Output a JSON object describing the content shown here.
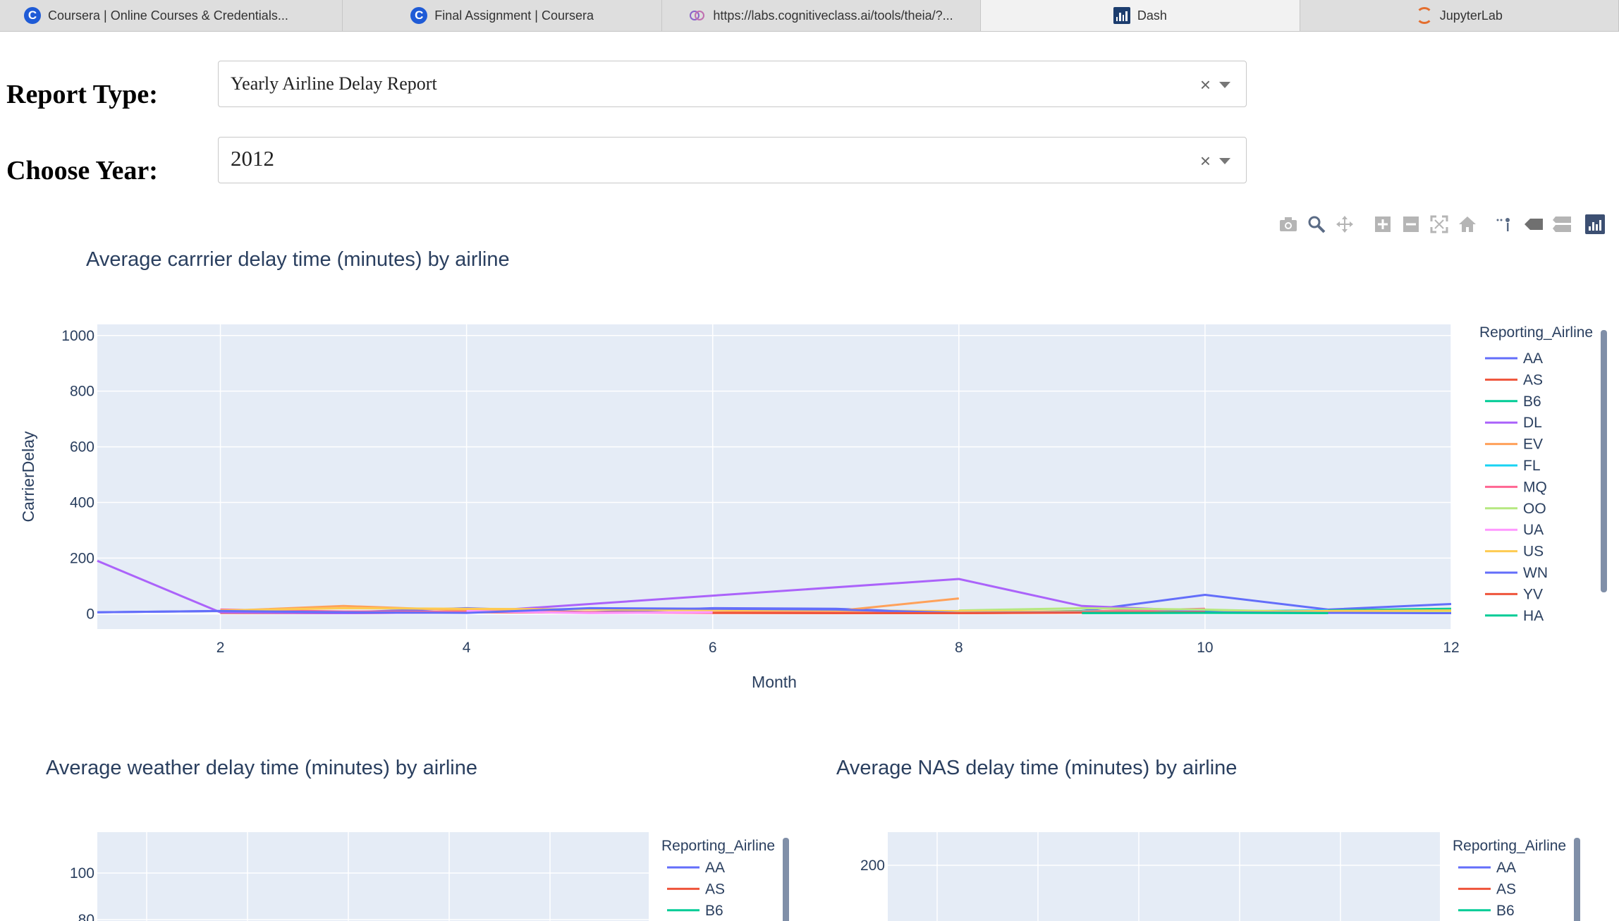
{
  "browser": {
    "tabs": [
      {
        "label": "Coursera | Online Courses & Credentials...",
        "icon": "coursera-icon"
      },
      {
        "label": "Final Assignment | Coursera",
        "icon": "coursera-icon"
      },
      {
        "label": "https://labs.cognitiveclass.ai/tools/theia/?...",
        "icon": "cognitiveclass-icon"
      },
      {
        "label": "Dash",
        "icon": "dash-icon"
      },
      {
        "label": "JupyterLab",
        "icon": "jupyter-icon"
      }
    ],
    "active_tab": 3
  },
  "controls": {
    "report_type_label": "Report Type:",
    "report_type_value": "Yearly Airline Delay Report",
    "year_label": "Choose Year:",
    "year_value": "2012",
    "clear_symbol": "×"
  },
  "modebar": {
    "icons": [
      "camera-icon",
      "zoom-icon",
      "pan-icon",
      "zoom-in-icon",
      "zoom-out-icon",
      "autoscale-icon",
      "reset-axes-icon",
      "spike-lines-icon",
      "hover-closest-icon",
      "hover-compare-icon",
      "plotly-logo-icon"
    ]
  },
  "chart_data": [
    {
      "type": "line",
      "title": "Average carrrier delay time (minutes) by airline",
      "xlabel": "Month",
      "ylabel": "CarrierDelay",
      "xlim": [
        1,
        12
      ],
      "ylim": [
        -55,
        1040
      ],
      "xticks": [
        2,
        4,
        6,
        8,
        10,
        12
      ],
      "yticks": [
        0,
        200,
        400,
        600,
        800,
        1000
      ],
      "legend_title": "Reporting_Airline",
      "legend_position": "right",
      "series": [
        {
          "name": "AA",
          "color": "#636efa",
          "x": [
            1,
            2,
            3,
            4,
            5,
            6,
            7,
            8,
            9,
            10,
            11,
            12
          ],
          "y": [
            5,
            10,
            5,
            20,
            5,
            20,
            18,
            2,
            10,
            68,
            15,
            35
          ]
        },
        {
          "name": "AS",
          "color": "#ef553b",
          "x": [
            2,
            3,
            4,
            6,
            7,
            8,
            9,
            10
          ],
          "y": [
            3,
            2,
            5,
            3,
            2,
            2,
            5,
            12
          ]
        },
        {
          "name": "B6",
          "color": "#00cc96",
          "x": [
            8,
            9,
            10,
            11,
            12
          ],
          "y": [
            5,
            10,
            8,
            12,
            18
          ]
        },
        {
          "name": "DL",
          "color": "#ab63fa",
          "x": [
            1,
            2,
            3,
            4,
            8,
            9,
            10
          ],
          "y": [
            190,
            5,
            2,
            5,
            125,
            28,
            10
          ]
        },
        {
          "name": "EV",
          "color": "#ffa15a",
          "x": [
            2,
            3,
            4,
            5,
            6,
            7,
            8
          ],
          "y": [
            10,
            28,
            12,
            5,
            5,
            10,
            55
          ]
        },
        {
          "name": "FL",
          "color": "#19d3f3",
          "x": [
            9,
            10,
            11
          ],
          "y": [
            10,
            5,
            12
          ]
        },
        {
          "name": "MQ",
          "color": "#ff6692",
          "x": [
            2,
            3,
            6,
            9,
            10
          ],
          "y": [
            15,
            8,
            3,
            8,
            18
          ]
        },
        {
          "name": "OO",
          "color": "#b6e880",
          "x": [
            8,
            9,
            10,
            11,
            12
          ],
          "y": [
            12,
            20,
            15,
            5,
            8
          ]
        },
        {
          "name": "UA",
          "color": "#ff97ff",
          "x": [
            4,
            5,
            6
          ],
          "y": [
            10,
            2,
            5
          ]
        },
        {
          "name": "US",
          "color": "#fecb52",
          "x": [
            2,
            3,
            10,
            11,
            12
          ],
          "y": [
            12,
            20,
            5,
            10,
            12
          ]
        },
        {
          "name": "WN",
          "color": "#636efa",
          "x": [
            1,
            2,
            3,
            4,
            5,
            6,
            7,
            8,
            9,
            10,
            11,
            12
          ],
          "y": [
            5,
            10,
            5,
            3,
            20,
            18,
            15,
            3,
            5,
            5,
            3,
            2
          ]
        },
        {
          "name": "YV",
          "color": "#ef553b",
          "x": [
            6,
            8,
            10
          ],
          "y": [
            3,
            2,
            5
          ]
        },
        {
          "name": "HA",
          "color": "#00cc96",
          "x": [
            9,
            10,
            11
          ],
          "y": [
            2,
            3,
            2
          ]
        }
      ]
    },
    {
      "type": "line",
      "title": "Average weather delay time (minutes) by airline",
      "xlabel": "",
      "ylabel": "",
      "yticks_visible": [
        100,
        80
      ],
      "legend_title": "Reporting_Airline",
      "legend_position": "right",
      "legend_entries": [
        {
          "name": "AA",
          "color": "#636efa"
        },
        {
          "name": "AS",
          "color": "#ef553b"
        },
        {
          "name": "B6",
          "color": "#00cc96"
        }
      ]
    },
    {
      "type": "line",
      "title": "Average NAS delay time (minutes) by airline",
      "xlabel": "",
      "ylabel": "",
      "yticks_visible": [
        200
      ],
      "legend_title": "Reporting_Airline",
      "legend_position": "right",
      "legend_entries": [
        {
          "name": "AA",
          "color": "#636efa"
        },
        {
          "name": "AS",
          "color": "#ef553b"
        },
        {
          "name": "B6",
          "color": "#00cc96"
        }
      ]
    }
  ]
}
